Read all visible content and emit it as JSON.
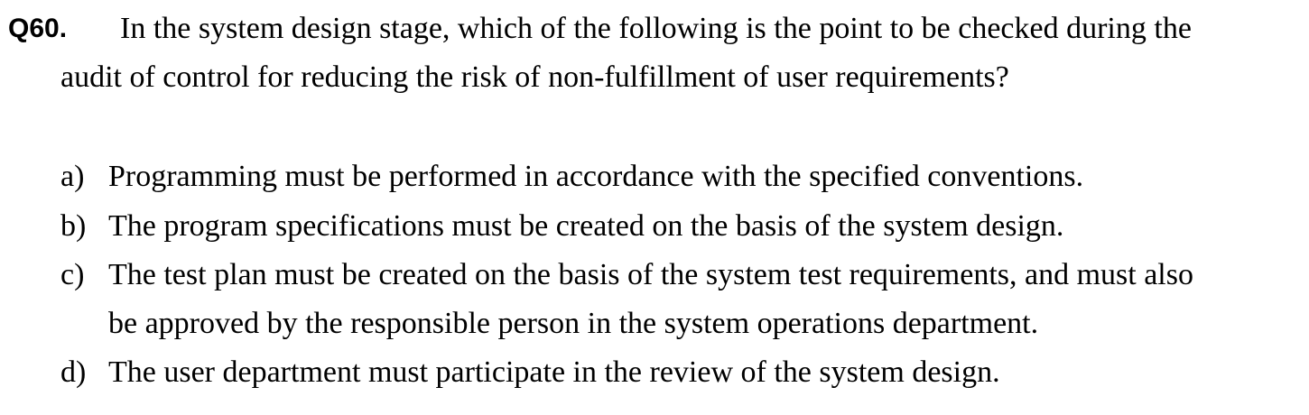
{
  "question": {
    "number": "Q60.",
    "stem_line_1": "In the system design stage, which of the following is the point to be checked during the",
    "stem_line_2": "audit of control for reducing the risk of non-fulfillment of user requirements?",
    "options": [
      {
        "letter": "a)",
        "lines": [
          "Programming must be performed in accordance with the specified conventions."
        ]
      },
      {
        "letter": "b)",
        "lines": [
          "The program specifications must be created on the basis of the system design."
        ]
      },
      {
        "letter": "c)",
        "lines": [
          "The test plan must be created on the basis of the system test requirements, and must also",
          "be approved by the responsible person in the system operations department."
        ]
      },
      {
        "letter": "d)",
        "lines": [
          "The user department must participate in the review of the system design."
        ]
      }
    ]
  }
}
